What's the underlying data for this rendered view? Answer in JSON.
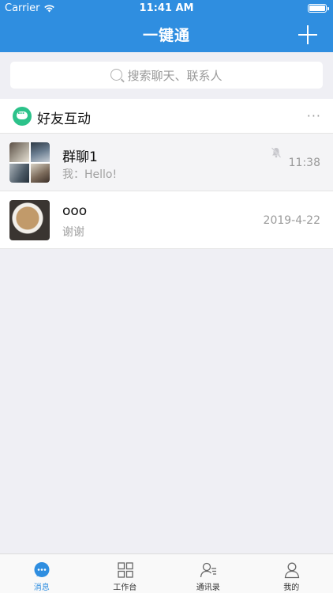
{
  "status_bar": {
    "carrier": "Carrier",
    "time": "11:41 AM"
  },
  "header": {
    "title": "一键通",
    "add_icon": "plus-icon"
  },
  "search": {
    "placeholder": "搜索聊天、联系人"
  },
  "section": {
    "title": "好友互动",
    "more": "···"
  },
  "conversations": [
    {
      "name": "群聊1",
      "last_message": "我：Hello!",
      "time": "11:38",
      "muted": true
    },
    {
      "name": "ooo",
      "last_message": "谢谢",
      "time": "2019-4-22",
      "muted": false
    }
  ],
  "tabs": [
    {
      "label": "消息",
      "icon": "message-icon",
      "active": true
    },
    {
      "label": "工作台",
      "icon": "grid-icon",
      "active": false
    },
    {
      "label": "通讯录",
      "icon": "contacts-icon",
      "active": false
    },
    {
      "label": "我的",
      "icon": "person-icon",
      "active": false
    }
  ],
  "colors": {
    "primary": "#2f8ee0",
    "accent_green": "#2cc28a"
  }
}
